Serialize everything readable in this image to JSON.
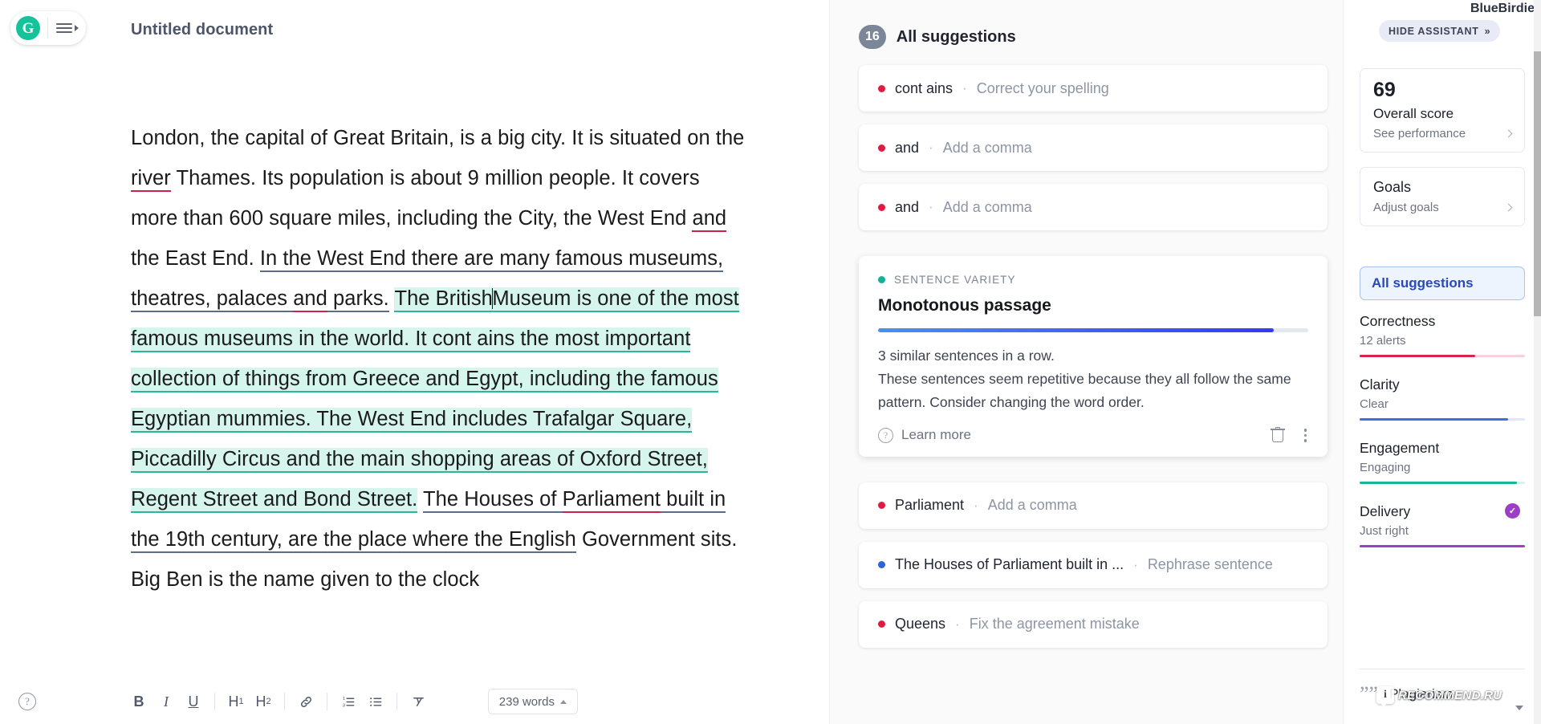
{
  "app": {
    "logo_letter": "G",
    "document_title": "Untitled document",
    "brand": "BlueBirdie"
  },
  "document": {
    "paragraph_html": "London, the capital of Great Britain, is a big city. It is situated on the <sp>river</sp> Thames. Its population is about 9 million people. It covers more than 600 square miles, including the City, the West End <sp>and</sp> the East End. <cl>In the West End there are many famous museums, theatres, palaces <sp>and</sp> parks.</cl> <hl>The British|Museum is one of the most famous museums in the world. It cont ains the most important collection of things from Greece and Egypt, including the famous Egyptian mummies. The West End includes Trafalgar Square, Piccadilly Circus and the main shopping areas of Oxford Street, Regent Street and Bond Street.</hl> <cl>The Houses of <sp>Parliament</sp> built in the 19th century, are the place where the English</cl> Government sits. Big Ben is the name given to the clock",
    "word_count": "239 words"
  },
  "toolbar": {
    "help_icon": "help-circle-icon",
    "buttons": [
      {
        "name": "bold",
        "label": "B"
      },
      {
        "name": "italic",
        "label": "I"
      },
      {
        "name": "underline",
        "label": "U"
      },
      {
        "name": "heading-1",
        "label": "H",
        "sub": "1"
      },
      {
        "name": "heading-2",
        "label": "H",
        "sub": "2"
      },
      {
        "name": "link",
        "label": "link-icon"
      },
      {
        "name": "ordered-list",
        "label": "ordered-list-icon"
      },
      {
        "name": "bulleted-list",
        "label": "bulleted-list-icon"
      },
      {
        "name": "clear-formatting",
        "label": "clear-formatting-icon"
      }
    ]
  },
  "suggestions": {
    "count": "16",
    "title": "All suggestions",
    "items": [
      {
        "dot": "red",
        "term": "cont ains",
        "sep": "·",
        "action": "Correct your spelling"
      },
      {
        "dot": "red",
        "term": "and",
        "sep": "·",
        "action": "Add a comma"
      },
      {
        "dot": "red",
        "term": "and",
        "sep": "·",
        "action": "Add a comma"
      }
    ],
    "expanded": {
      "category": "SENTENCE VARIETY",
      "title": "Monotonous passage",
      "progress_percent": 92,
      "description_line1": "3 similar sentences in a row.",
      "description_line2": "These sentences seem repetitive because they all follow the same pattern. Consider changing the word order.",
      "learn_more": "Learn more",
      "delete_icon": "trash-icon",
      "more_icon": "kebab-menu-icon"
    },
    "items_after": [
      {
        "dot": "red",
        "term": "Parliament",
        "sep": "·",
        "action": "Add a comma"
      },
      {
        "dot": "blue",
        "term": "The Houses of Parliament built in ...",
        "sep": "·",
        "action": "Rephrase sentence"
      },
      {
        "dot": "red",
        "term": "Queens",
        "sep": "·",
        "action": "Fix the agreement mistake"
      }
    ]
  },
  "assistant": {
    "hide_label": "HIDE ASSISTANT",
    "hide_chevrons": "»",
    "overall_score": {
      "value": "69",
      "label": "Overall score",
      "link": "See performance"
    },
    "goals": {
      "label": "Goals",
      "link": "Adjust goals"
    },
    "all_suggestions_button": "All suggestions",
    "metrics": [
      {
        "name": "Correctness",
        "value": "12 alerts",
        "percent": 70,
        "color": "#d8234a",
        "track": "#f7d2da",
        "badge": ""
      },
      {
        "name": "Clarity",
        "value": "Clear",
        "percent": 90,
        "color": "#3f6fd8",
        "track": "#dfe8f8",
        "badge": ""
      },
      {
        "name": "Engagement",
        "value": "Engaging",
        "percent": 95,
        "color": "#18b795",
        "track": "#d7f3ec",
        "badge": ""
      },
      {
        "name": "Delivery",
        "value": "Just right",
        "percent": 100,
        "color": "#9b3fc7",
        "track": "#ecd9f5",
        "badge": "check-badge-icon"
      }
    ],
    "plagiarism": {
      "icon": "quote-icon",
      "label": "Plagiarism"
    }
  },
  "watermark": {
    "badge": "i",
    "text": "RECOMMEND.RU"
  },
  "colors": {
    "brand_green": "#15c39a",
    "spelling_red": "#c8234a",
    "clarity_blue": "#5c6d8c",
    "highlight_mint": "#d6f5ec",
    "accent_blue": "#2a49b8"
  }
}
